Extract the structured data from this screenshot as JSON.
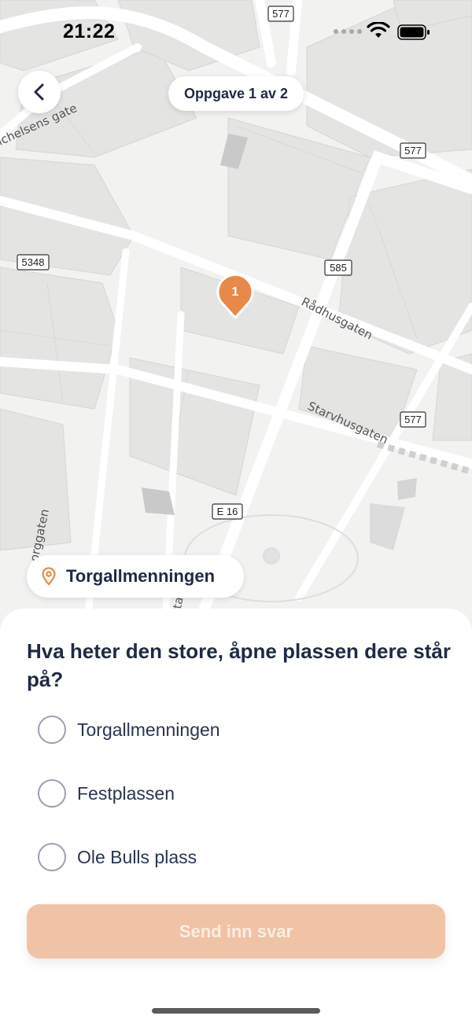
{
  "status_bar": {
    "time": "21:22"
  },
  "header": {
    "progress_label": "Oppgave 1 av 2"
  },
  "map": {
    "street_labels": [
      "ichelsens gate",
      "Rådhusgaten",
      "Starvhusgaten",
      "orggaten",
      "tal"
    ],
    "road_shields": [
      "577",
      "577",
      "585",
      "577",
      "5348",
      "E 16"
    ],
    "marker_number": "1",
    "marker_color": "#e8894a"
  },
  "location": {
    "name": "Torgallmenningen"
  },
  "quiz": {
    "question": "Hva heter den store, åpne plassen dere står på?",
    "options": [
      "Torgallmenningen",
      "Festplassen",
      "Ole Bulls plass"
    ],
    "submit_label": "Send inn svar"
  },
  "colors": {
    "accent": "#e8894a",
    "button_disabled": "#f0c3a7",
    "text_dark": "#1f2a44"
  }
}
